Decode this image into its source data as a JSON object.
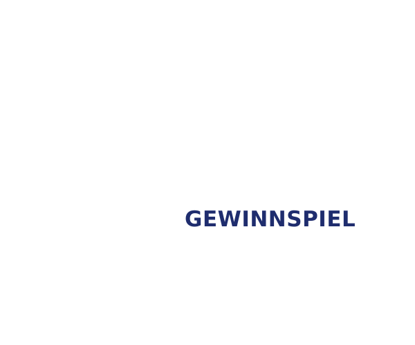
{
  "headline": {
    "text": "GEWINNSPIEL",
    "color": "#1f2d6e"
  },
  "background_color": "#ffffff"
}
